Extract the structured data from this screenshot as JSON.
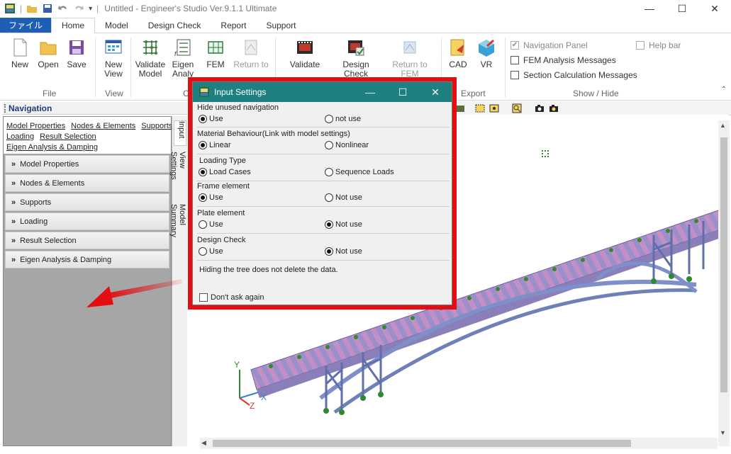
{
  "window": {
    "title": "Untitled - Engineer's Studio Ver.9.1.1 Ultimate",
    "minimize_icon": "minimize-icon",
    "maximize_icon": "maximize-icon",
    "close_icon": "close-icon"
  },
  "tabs": [
    {
      "label": "ファイル"
    },
    {
      "label": "Home"
    },
    {
      "label": "Model"
    },
    {
      "label": "Design Check"
    },
    {
      "label": "Report"
    },
    {
      "label": "Support"
    }
  ],
  "ribbon": {
    "file_group": {
      "label": "File",
      "new": "New",
      "open": "Open",
      "save": "Save"
    },
    "view_group": {
      "label": "View",
      "new_view_1": "New",
      "new_view_2": "View"
    },
    "validate_model_1": "Validate",
    "validate_model_2": "Model",
    "eigen_1": "Eigen",
    "eigen_2": "Analy",
    "fem": "FEM",
    "return_to_1": "Return to",
    "group_c": "C",
    "validate": "Validate",
    "design_check": "Design Check",
    "return_to_fem": "Return to FEM",
    "cad": "CAD",
    "vr": "VR",
    "export_label": "Export",
    "show_hide_label": "Show / Hide",
    "navigation_panel": "Navigation Panel",
    "fem_messages": "FEM Analysis Messages",
    "section_messages": "Section Calculation Messages",
    "help_bar": "Help bar"
  },
  "navigation": {
    "header": "Navigation",
    "links": [
      "Model Properties",
      "Nodes & Elements",
      "Supports",
      "Loading",
      "Result Selection",
      "Eigen Analysis & Damping"
    ],
    "sections": [
      "Model Properties",
      "Nodes & Elements",
      "Supports",
      "Loading",
      "Result Selection",
      "Eigen Analysis & Damping"
    ],
    "side_tabs": [
      "Input",
      "View Settings",
      "Model Summary"
    ]
  },
  "dialog": {
    "title": "Input Settings",
    "groups": [
      {
        "title": "Hide unused navigation",
        "opt1": "Use",
        "opt2": "not use",
        "selected": 1
      },
      {
        "title": "Material Behaviour(Link with model settings)",
        "opt1": "Linear",
        "opt2": "Nonlinear",
        "selected": 1
      },
      {
        "title": "Loading Type",
        "opt1": "Load Cases",
        "opt2": "Sequence Loads",
        "selected": 1
      },
      {
        "title": "Frame element",
        "opt1": "Use",
        "opt2": "Not use",
        "selected": 1
      },
      {
        "title": "Plate element",
        "opt1": "Use",
        "opt2": "Not use",
        "selected": 2
      },
      {
        "title": "Design Check",
        "opt1": "Use",
        "opt2": "Not use",
        "selected": 2
      }
    ],
    "note": "Hiding the tree does not delete the data.",
    "dont_ask": "Don't ask again"
  },
  "viewport": {
    "axis_y": "Y",
    "axis_x": "X",
    "axis_z": "Z"
  },
  "colors": {
    "accent_file_tab": "#1e5fb4",
    "dialog_title": "#1e8080",
    "highlight_frame": "#e40d12",
    "deck_purple": "#9b8fc9",
    "node_green": "#2f8a2f"
  }
}
